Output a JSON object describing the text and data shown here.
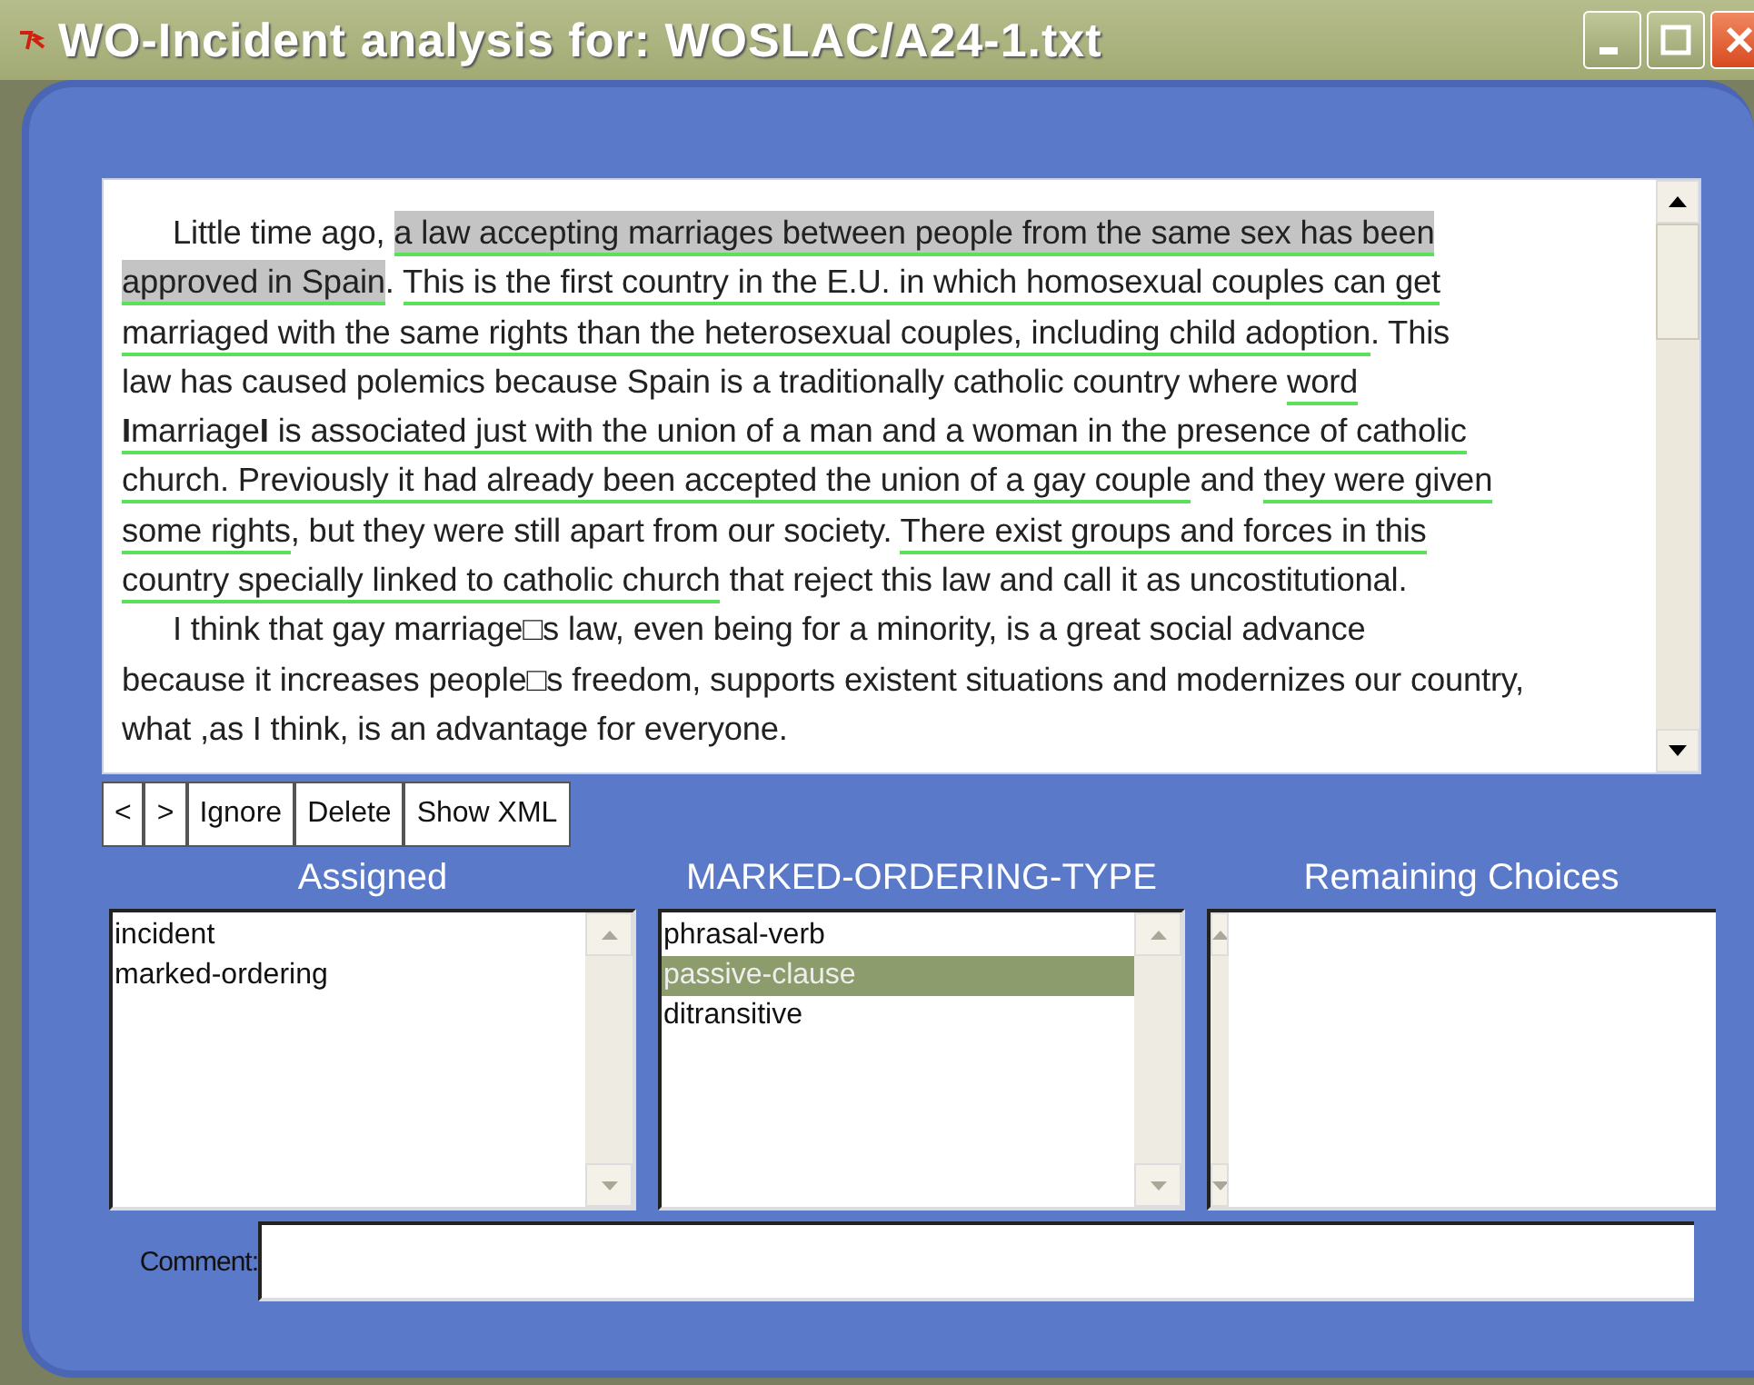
{
  "window": {
    "title": "WO-Incident analysis for: WOSLAC/A24-1.txt"
  },
  "text_lines": [
    {
      "indent": true,
      "segments": [
        {
          "text": "Little time ago, ",
          "highlighted": false,
          "underlined": false
        },
        {
          "text": "a law accepting marriages between people from the same sex has been",
          "highlighted": true,
          "underlined": true
        }
      ]
    },
    {
      "indent": false,
      "segments": [
        {
          "text": "approved in Spain",
          "highlighted": true,
          "underlined": true
        },
        {
          "text": ". ",
          "highlighted": false,
          "underlined": false
        },
        {
          "text": "This is the first country in the E.U. in which homosexual couples can get",
          "highlighted": false,
          "underlined": true
        }
      ]
    },
    {
      "indent": false,
      "segments": [
        {
          "text": "marriaged with the same rights than the heterosexual couples, including child adoption",
          "highlighted": false,
          "underlined": true
        },
        {
          "text": ". This",
          "highlighted": false,
          "underlined": false
        }
      ]
    },
    {
      "indent": false,
      "segments": [
        {
          "text": "law has caused polemics because Spain is a traditionally catholic country where ",
          "highlighted": false,
          "underlined": false
        },
        {
          "text": "word",
          "highlighted": false,
          "underlined": true
        }
      ]
    },
    {
      "indent": false,
      "segments": [
        {
          "text": "**I**marriage**I** is associated just with the union of a man and a woman in the presence of catholic",
          "highlighted": false,
          "underlined": true
        }
      ]
    },
    {
      "indent": false,
      "segments": [
        {
          "text": "church. ",
          "highlighted": false,
          "underlined": true
        },
        {
          "text": "Previously it had already been accepted the union of a gay couple",
          "highlighted": false,
          "underlined": true
        },
        {
          "text": " and ",
          "highlighted": false,
          "underlined": false
        },
        {
          "text": "they were given",
          "highlighted": false,
          "underlined": true
        }
      ]
    },
    {
      "indent": false,
      "segments": [
        {
          "text": "some rights",
          "highlighted": false,
          "underlined": true
        },
        {
          "text": ", but they were still apart from our society. ",
          "highlighted": false,
          "underlined": false
        },
        {
          "text": "There exist groups and forces in this",
          "highlighted": false,
          "underlined": true
        }
      ]
    },
    {
      "indent": false,
      "segments": [
        {
          "text": "country specially linked to catholic church",
          "highlighted": false,
          "underlined": true
        },
        {
          "text": " that reject this law and call it as uncostitutional.",
          "highlighted": false,
          "underlined": false
        }
      ]
    },
    {
      "indent": true,
      "segments": [
        {
          "text": "I think that gay marriage□s law, even being for a minority, is a great social advance",
          "highlighted": false,
          "underlined": false
        }
      ]
    },
    {
      "indent": false,
      "segments": [
        {
          "text": "because it increases people□s freedom, supports existent situations and modernizes our country,",
          "highlighted": false,
          "underlined": false
        }
      ]
    },
    {
      "indent": false,
      "segments": [
        {
          "text": "what ,as I think, is an advantage for everyone.",
          "highlighted": false,
          "underlined": false
        }
      ]
    }
  ],
  "buttons": [
    "<",
    ">",
    "Ignore",
    "Delete",
    "Show XML"
  ],
  "lists": [
    {
      "heading": "Assigned",
      "items": [
        {
          "label": "incident",
          "selected": false
        },
        {
          "label": "marked-ordering",
          "selected": false
        }
      ]
    },
    {
      "heading": "MARKED-ORDERING-TYPE",
      "items": [
        {
          "label": "phrasal-verb",
          "selected": false
        },
        {
          "label": "passive-clause",
          "selected": true
        },
        {
          "label": "ditransitive",
          "selected": false
        }
      ]
    },
    {
      "heading": "Remaining Choices"
    }
  ],
  "comment": {
    "label": "Comment:"
  }
}
